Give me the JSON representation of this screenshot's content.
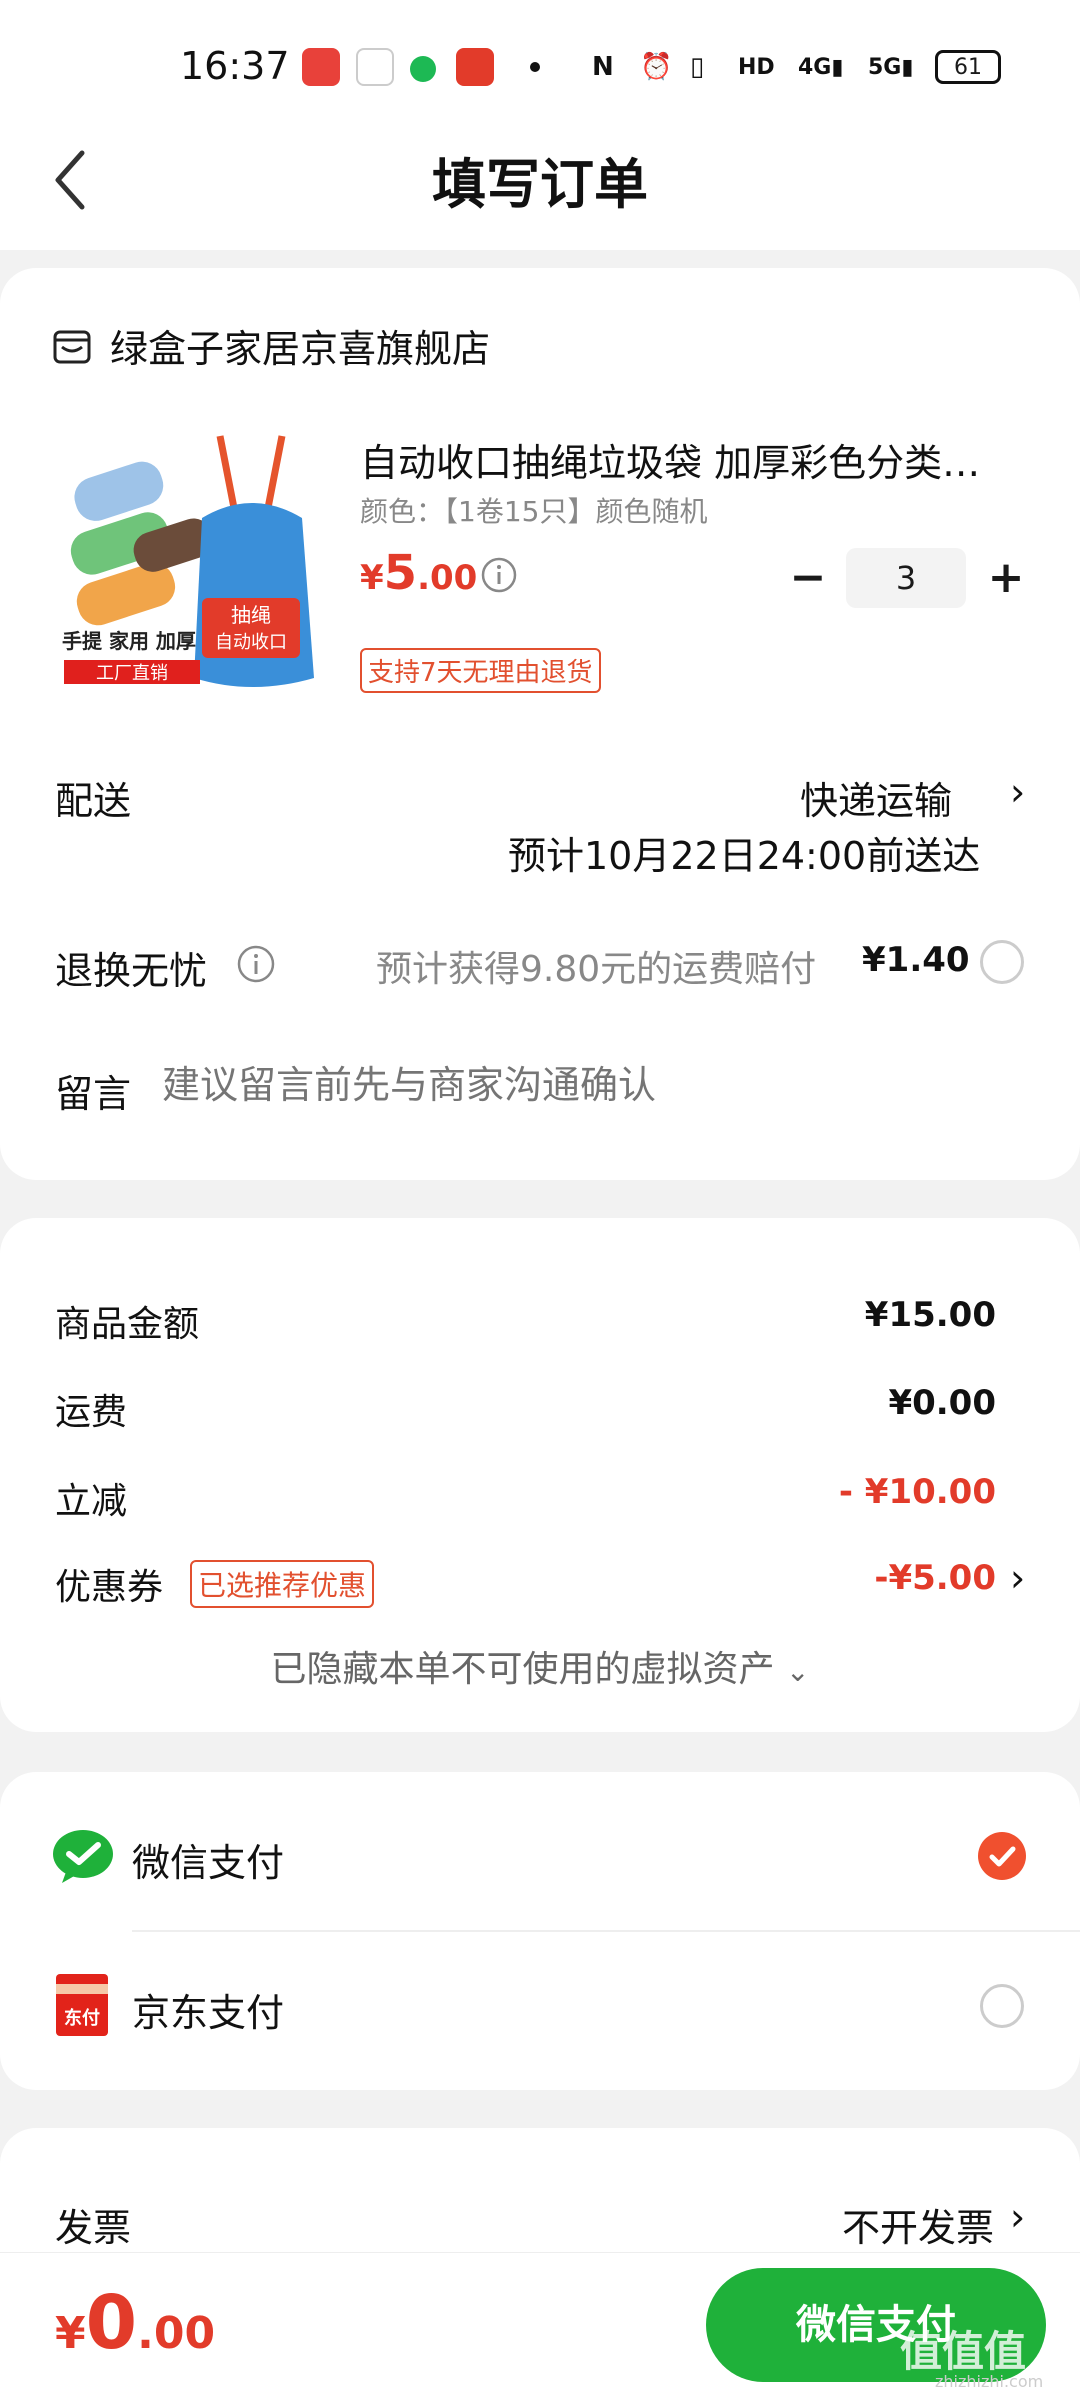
{
  "status_bar": {
    "time": "16:37",
    "network_icons": [
      "nfc-icon",
      "alarm-icon",
      "vibrate-icon",
      "hd-icon",
      "signal-4g-icon",
      "signal-5g-icon"
    ],
    "battery": "61"
  },
  "header": {
    "title": "填写订单"
  },
  "shop": {
    "name": "绿盒子家居京喜旗舰店"
  },
  "product": {
    "title": "自动收口抽绳垃圾袋 加厚彩色分类垃圾袋",
    "spec": "颜色：【1卷15只】颜色随机",
    "price_currency": "¥",
    "price_int": "5",
    "price_dec": ".00",
    "quantity": "3",
    "return_badge": "支持7天无理由退货",
    "image_text_top": "抽绳",
    "image_text_bottom": "自动收口",
    "image_caption": "手提 家用 加厚",
    "image_banner": "工厂直销"
  },
  "delivery": {
    "label": "配送",
    "method": "快递运输",
    "eta": "预计10月22日24:00前送达"
  },
  "return_insurance": {
    "label": "退换无忧",
    "hint": "预计获得9.80元的运费赔付",
    "price": "¥1.40"
  },
  "note": {
    "label": "留言",
    "placeholder": "建议留言前先与商家沟通确认"
  },
  "summary": {
    "goods_label": "商品金额",
    "goods_value": "¥15.00",
    "shipping_label": "运费",
    "shipping_value": "¥0.00",
    "discount_label": "立减",
    "discount_value": "- ¥10.00",
    "coupon_label": "优惠券",
    "coupon_badge": "已选推荐优惠",
    "coupon_value": "-¥5.00",
    "hidden_assets": "已隐藏本单不可使用的虚拟资产"
  },
  "payment": {
    "wechat_label": "微信支付",
    "jd_label": "京东支付",
    "jd_icon_text": "东付"
  },
  "invoice": {
    "label": "发票",
    "value": "不开发票"
  },
  "bottom": {
    "total_currency": "¥",
    "total_int": "0",
    "total_dec": ".00",
    "pay_button": "微信支付",
    "watermark": "值值值",
    "watermark_sub": "zhizhizhi.com"
  },
  "colors": {
    "accent_red": "#e23b2a",
    "wechat_green": "#1fb13a",
    "check_orange": "#f0502f"
  }
}
